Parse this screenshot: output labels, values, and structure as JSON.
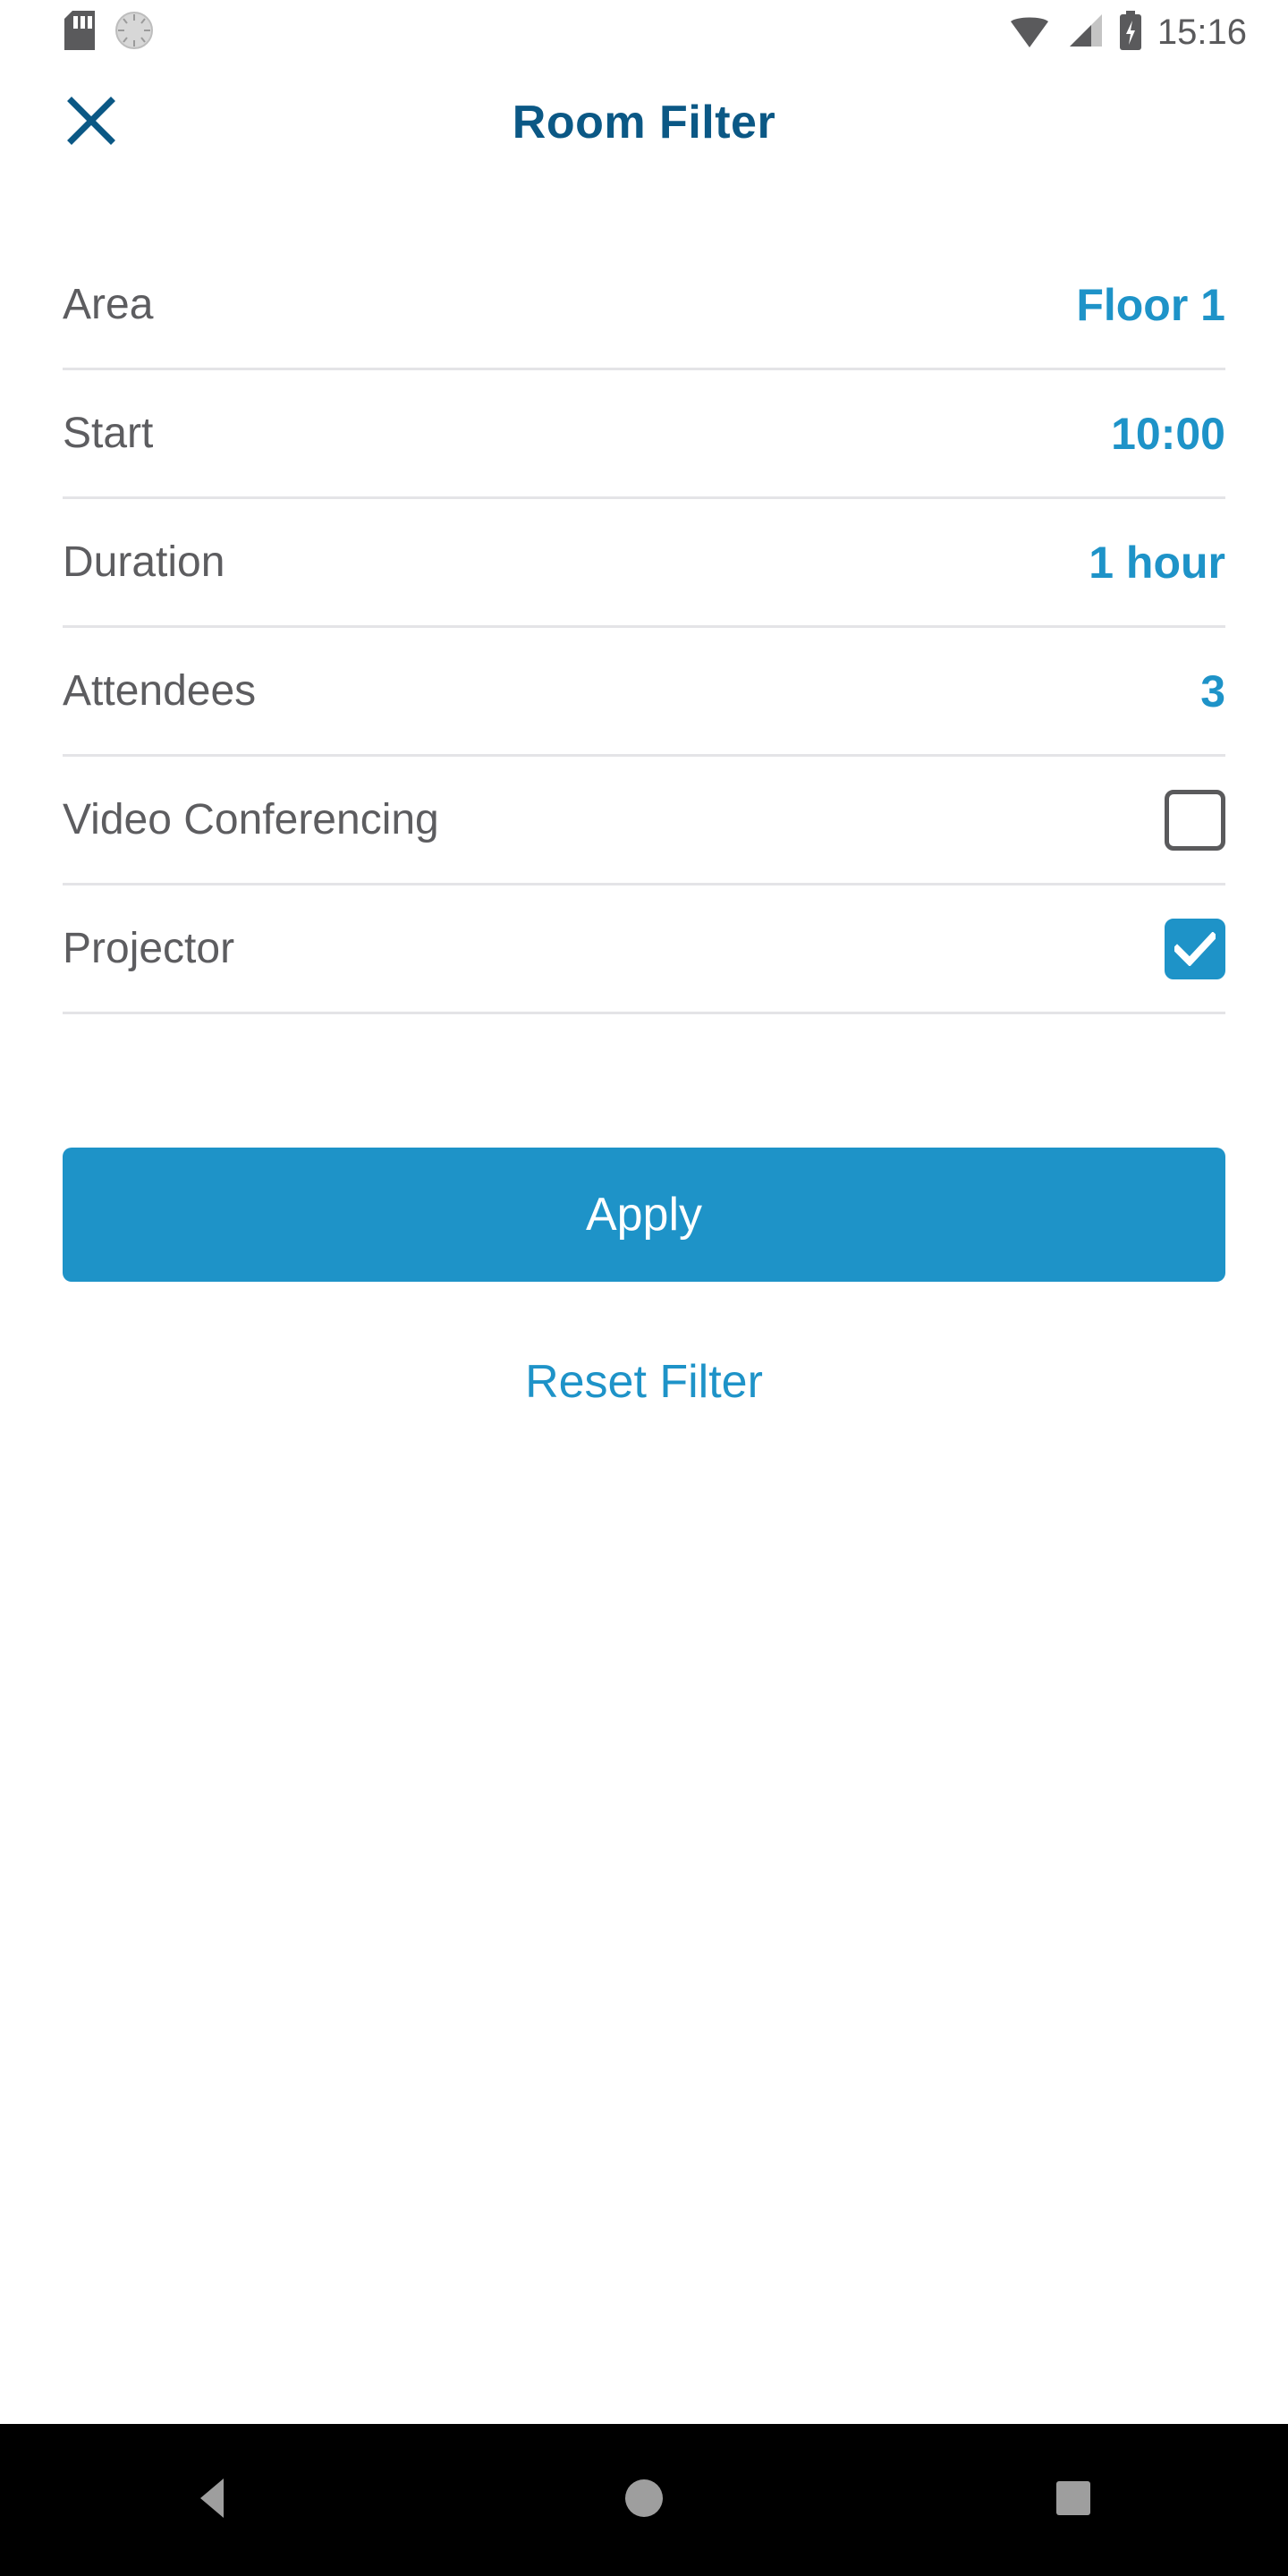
{
  "statusbar": {
    "time": "15:16",
    "icons": [
      "sd-card-icon",
      "sync-spinner-icon",
      "wifi-icon",
      "cell-signal-icon",
      "battery-charging-icon"
    ]
  },
  "appbar": {
    "title": "Room Filter",
    "close_icon": "close-icon"
  },
  "filter_rows": [
    {
      "label": "Area",
      "value": "Floor 1",
      "type": "value"
    },
    {
      "label": "Start",
      "value": "10:00",
      "type": "value"
    },
    {
      "label": "Duration",
      "value": "1 hour",
      "type": "value"
    },
    {
      "label": "Attendees",
      "value": "3",
      "type": "value"
    },
    {
      "label": "Video Conferencing",
      "value": "",
      "type": "checkbox",
      "checked": false
    },
    {
      "label": "Projector",
      "value": "",
      "type": "checkbox",
      "checked": true
    }
  ],
  "actions": {
    "apply_label": "Apply",
    "reset_label": "Reset Filter"
  },
  "navbar": {
    "back_icon": "back-triangle-icon",
    "home_icon": "home-circle-icon",
    "recents_icon": "recents-square-icon"
  },
  "colors": {
    "accent_blue": "#1e93c8",
    "title_blue": "#0b5885",
    "label_gray": "#5d5d60",
    "divider": "#e4e4e7",
    "nav_icon": "#9e9e9e",
    "nav_bg": "#000000"
  }
}
